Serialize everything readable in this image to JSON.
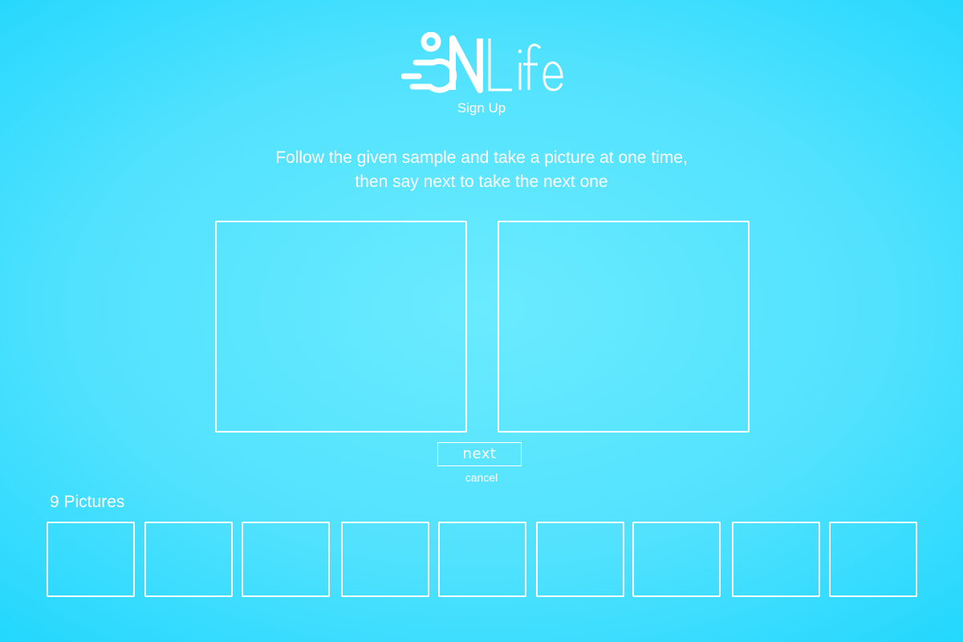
{
  "app": {
    "logo_text": "3NLife",
    "subtitle": "Sign Up"
  },
  "instructions": {
    "line1": "Follow the given sample and take a picture at one time,",
    "line2": "then say next to take the next one"
  },
  "actions": {
    "next_label": "next",
    "cancel_label": "cancel"
  },
  "gallery": {
    "title": "9 Pictures",
    "count": 9
  },
  "colors": {
    "background": "#52e2fe",
    "foreground": "#ffffff"
  }
}
